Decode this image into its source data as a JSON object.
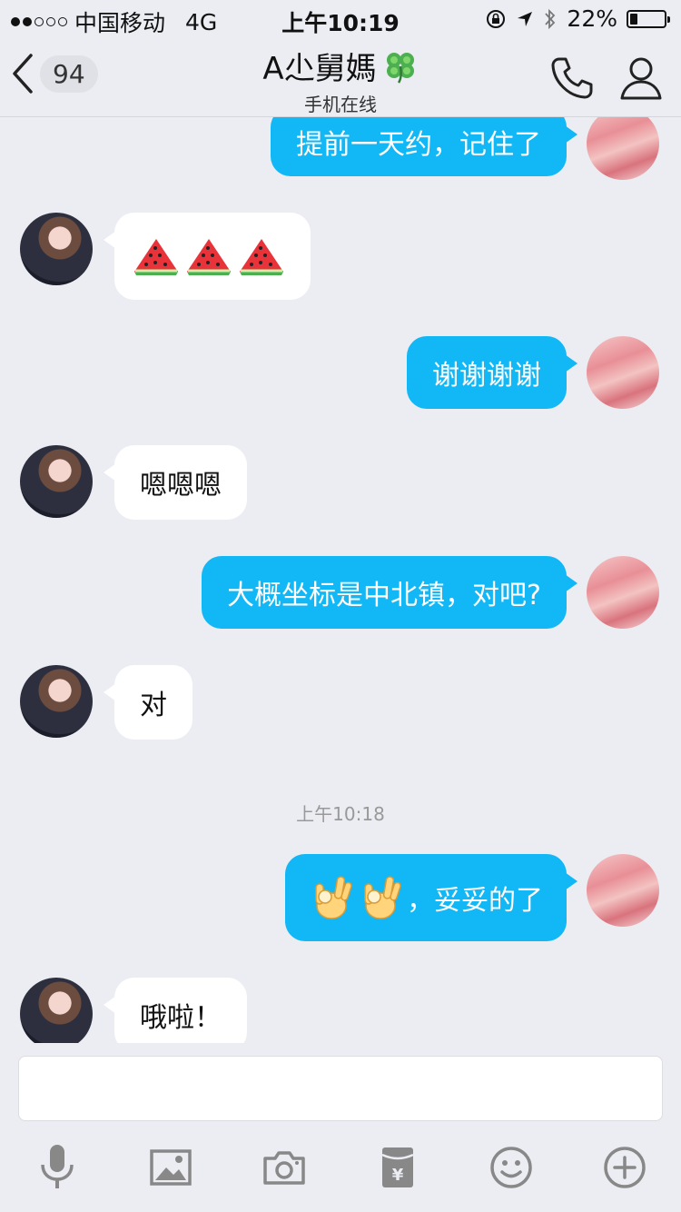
{
  "status_bar": {
    "carrier": "中国移动",
    "network": "4G",
    "time": "上午10:19",
    "battery": "22%",
    "battery_level": 0.22
  },
  "nav": {
    "back_count": "94",
    "contact_name": "A尐舅媽",
    "contact_name_icon": "four-leaf-clover-icon",
    "status": "手机在线"
  },
  "messages": [
    {
      "side": "out",
      "text": "提前一天约，记住了"
    },
    {
      "side": "in",
      "emoji": [
        "watermelon-icon",
        "watermelon-icon",
        "watermelon-icon"
      ]
    },
    {
      "side": "out",
      "text": "谢谢谢谢"
    },
    {
      "side": "in",
      "text": "嗯嗯嗯"
    },
    {
      "side": "out",
      "text": "大概坐标是中北镇，对吧?"
    },
    {
      "side": "in",
      "text": "对"
    },
    {
      "side": "out",
      "text": "，妥妥的了",
      "emoji": [
        "ok-hand-icon",
        "ok-hand-icon"
      ]
    },
    {
      "side": "in",
      "text": "哦啦！"
    }
  ],
  "timestamp": "上午10:18",
  "colors": {
    "background": "#ebedf2",
    "outgoing_bubble": "#12b7f5",
    "incoming_bubble": "#ffffff"
  },
  "toolbar": [
    "microphone-icon",
    "image-icon",
    "camera-icon",
    "red-envelope-icon",
    "emoji-icon",
    "plus-icon"
  ]
}
